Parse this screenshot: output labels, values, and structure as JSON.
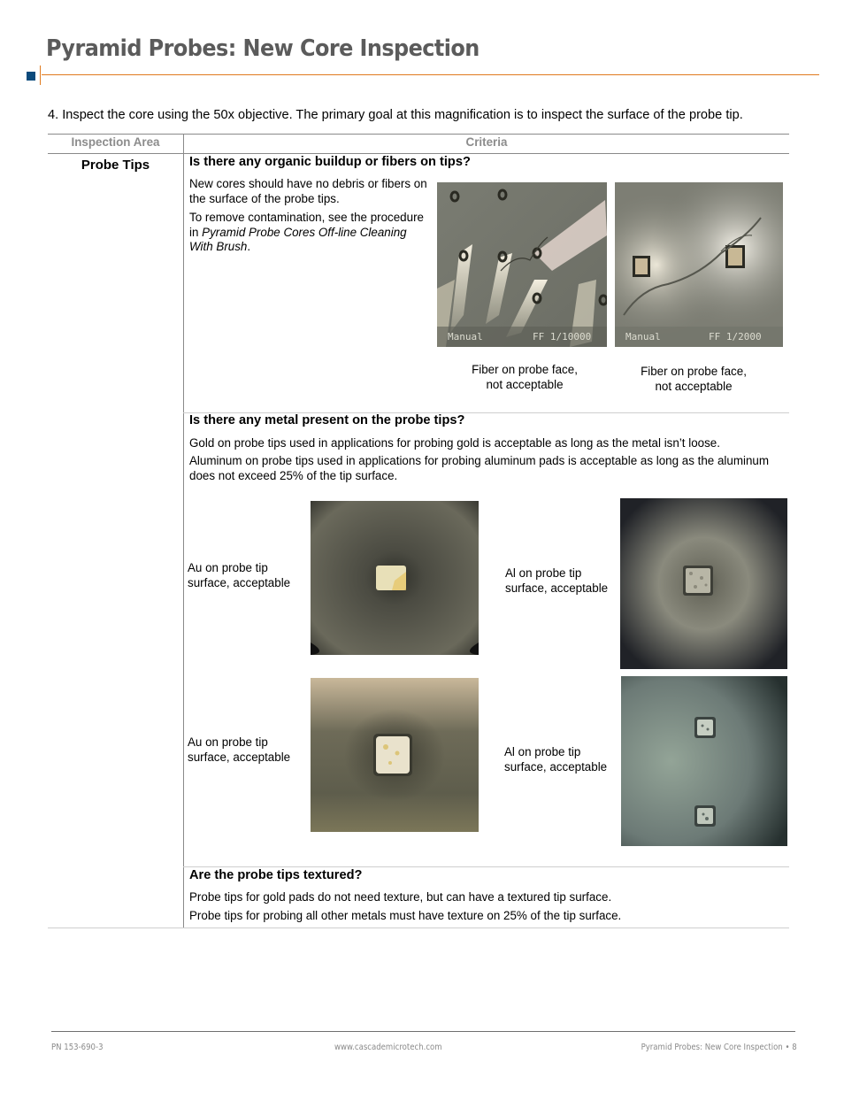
{
  "header": {
    "title": "Pyramid Probes: New Core Inspection",
    "accent_color": "#e07a1e",
    "square_color": "#0b4a7c"
  },
  "step": {
    "text": "4.  Inspect the core using the 50x objective. The primary goal at this magnification is to inspect the surface of the probe tip."
  },
  "table": {
    "headers": [
      "Inspection Area",
      "Criteria"
    ],
    "area": "Probe Tips",
    "sections": [
      {
        "question": "Is there any organic buildup or fibers on tips?",
        "paragraphs": [
          "New cores should have no debris or fibers on the surface of the probe tips.",
          "To remove contamination, see the procedure in ",
          "Pyramid Probe Cores Off-line Cleaning With Brush",
          "."
        ],
        "images": [
          {
            "caption_line1": "Fiber on probe face,",
            "caption_line2": "not acceptable",
            "overlay_left": "Manual",
            "overlay_right": "FF 1/10000"
          },
          {
            "caption_line1": "Fiber on probe face,",
            "caption_line2": "not acceptable",
            "overlay_left": "Manual",
            "overlay_right": "FF 1/2000"
          }
        ]
      },
      {
        "question": "Is there any metal present on the probe tips?",
        "paragraphs": [
          "Gold on probe tips used in applications for probing gold is acceptable as long as the metal isn’t loose.",
          "Aluminum on probe tips used in applications for probing aluminum pads is acceptable as long as the aluminum does not exceed 25% of the tip surface."
        ],
        "images": [
          {
            "caption_line1": "Au on probe tip",
            "caption_line2": "surface, acceptable"
          },
          {
            "caption_line1": "Al on probe tip",
            "caption_line2": "surface, acceptable"
          },
          {
            "caption_line1": "Au on probe tip",
            "caption_line2": "surface, acceptable"
          },
          {
            "caption_line1": "Al on probe tip",
            "caption_line2": "surface, acceptable"
          }
        ]
      },
      {
        "question": "Are the probe tips textured?",
        "paragraphs": [
          "Probe tips for gold pads do not need texture, but can have a textured tip surface.",
          "Probe tips for probing all other metals must have texture on 25% of the tip surface."
        ]
      }
    ]
  },
  "footer": {
    "part_number": "PN 153-690-3",
    "website": "www.cascademicrotech.com",
    "page_label": "Pyramid Probes: New Core Inspection • 8"
  }
}
